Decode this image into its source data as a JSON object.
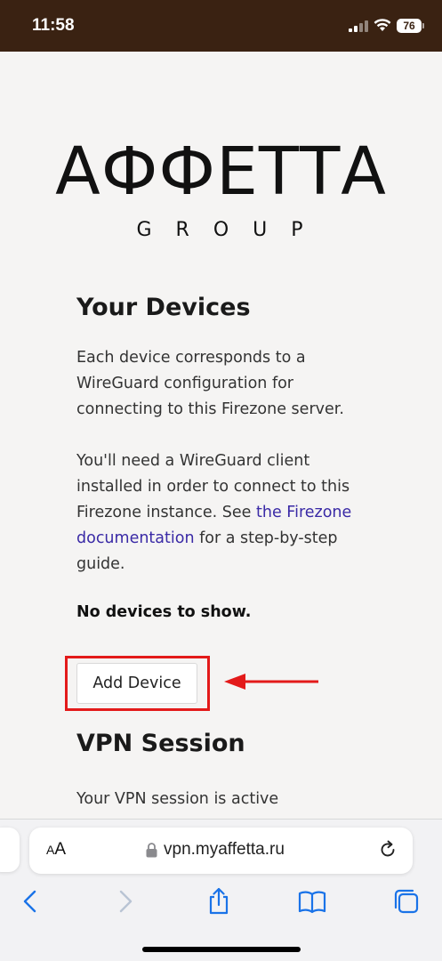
{
  "status_bar": {
    "time": "11:58",
    "battery": "76",
    "icons": [
      "signal-icon",
      "wifi-icon",
      "battery-icon"
    ]
  },
  "logo": {
    "main": "АФФЕТТА",
    "sub": "GROUP"
  },
  "devices": {
    "title": "Your Devices",
    "para1": "Each device corresponds to a WireGuard configuration for connecting to this Firezone server.",
    "para2_before": "You'll need a WireGuard client installed in order to connect to this Firezone instance. See ",
    "para2_link": "the Firezone documentation",
    "para2_after": " for a step-by-step guide.",
    "empty_state": "No devices to show.",
    "add_button": "Add Device"
  },
  "vpn": {
    "title": "VPN Session",
    "status": "Your VPN session is active"
  },
  "browser": {
    "aa_label_small": "A",
    "aa_label_large": "A",
    "url": "vpn.myaffetta.ru",
    "toolbar_icons": [
      "back-icon",
      "forward-icon",
      "share-icon",
      "bookmarks-icon",
      "tabs-icon"
    ]
  },
  "colors": {
    "status_bar_bg": "#3a2212",
    "link": "#3a2aa6",
    "annotation": "#e31a1a"
  }
}
